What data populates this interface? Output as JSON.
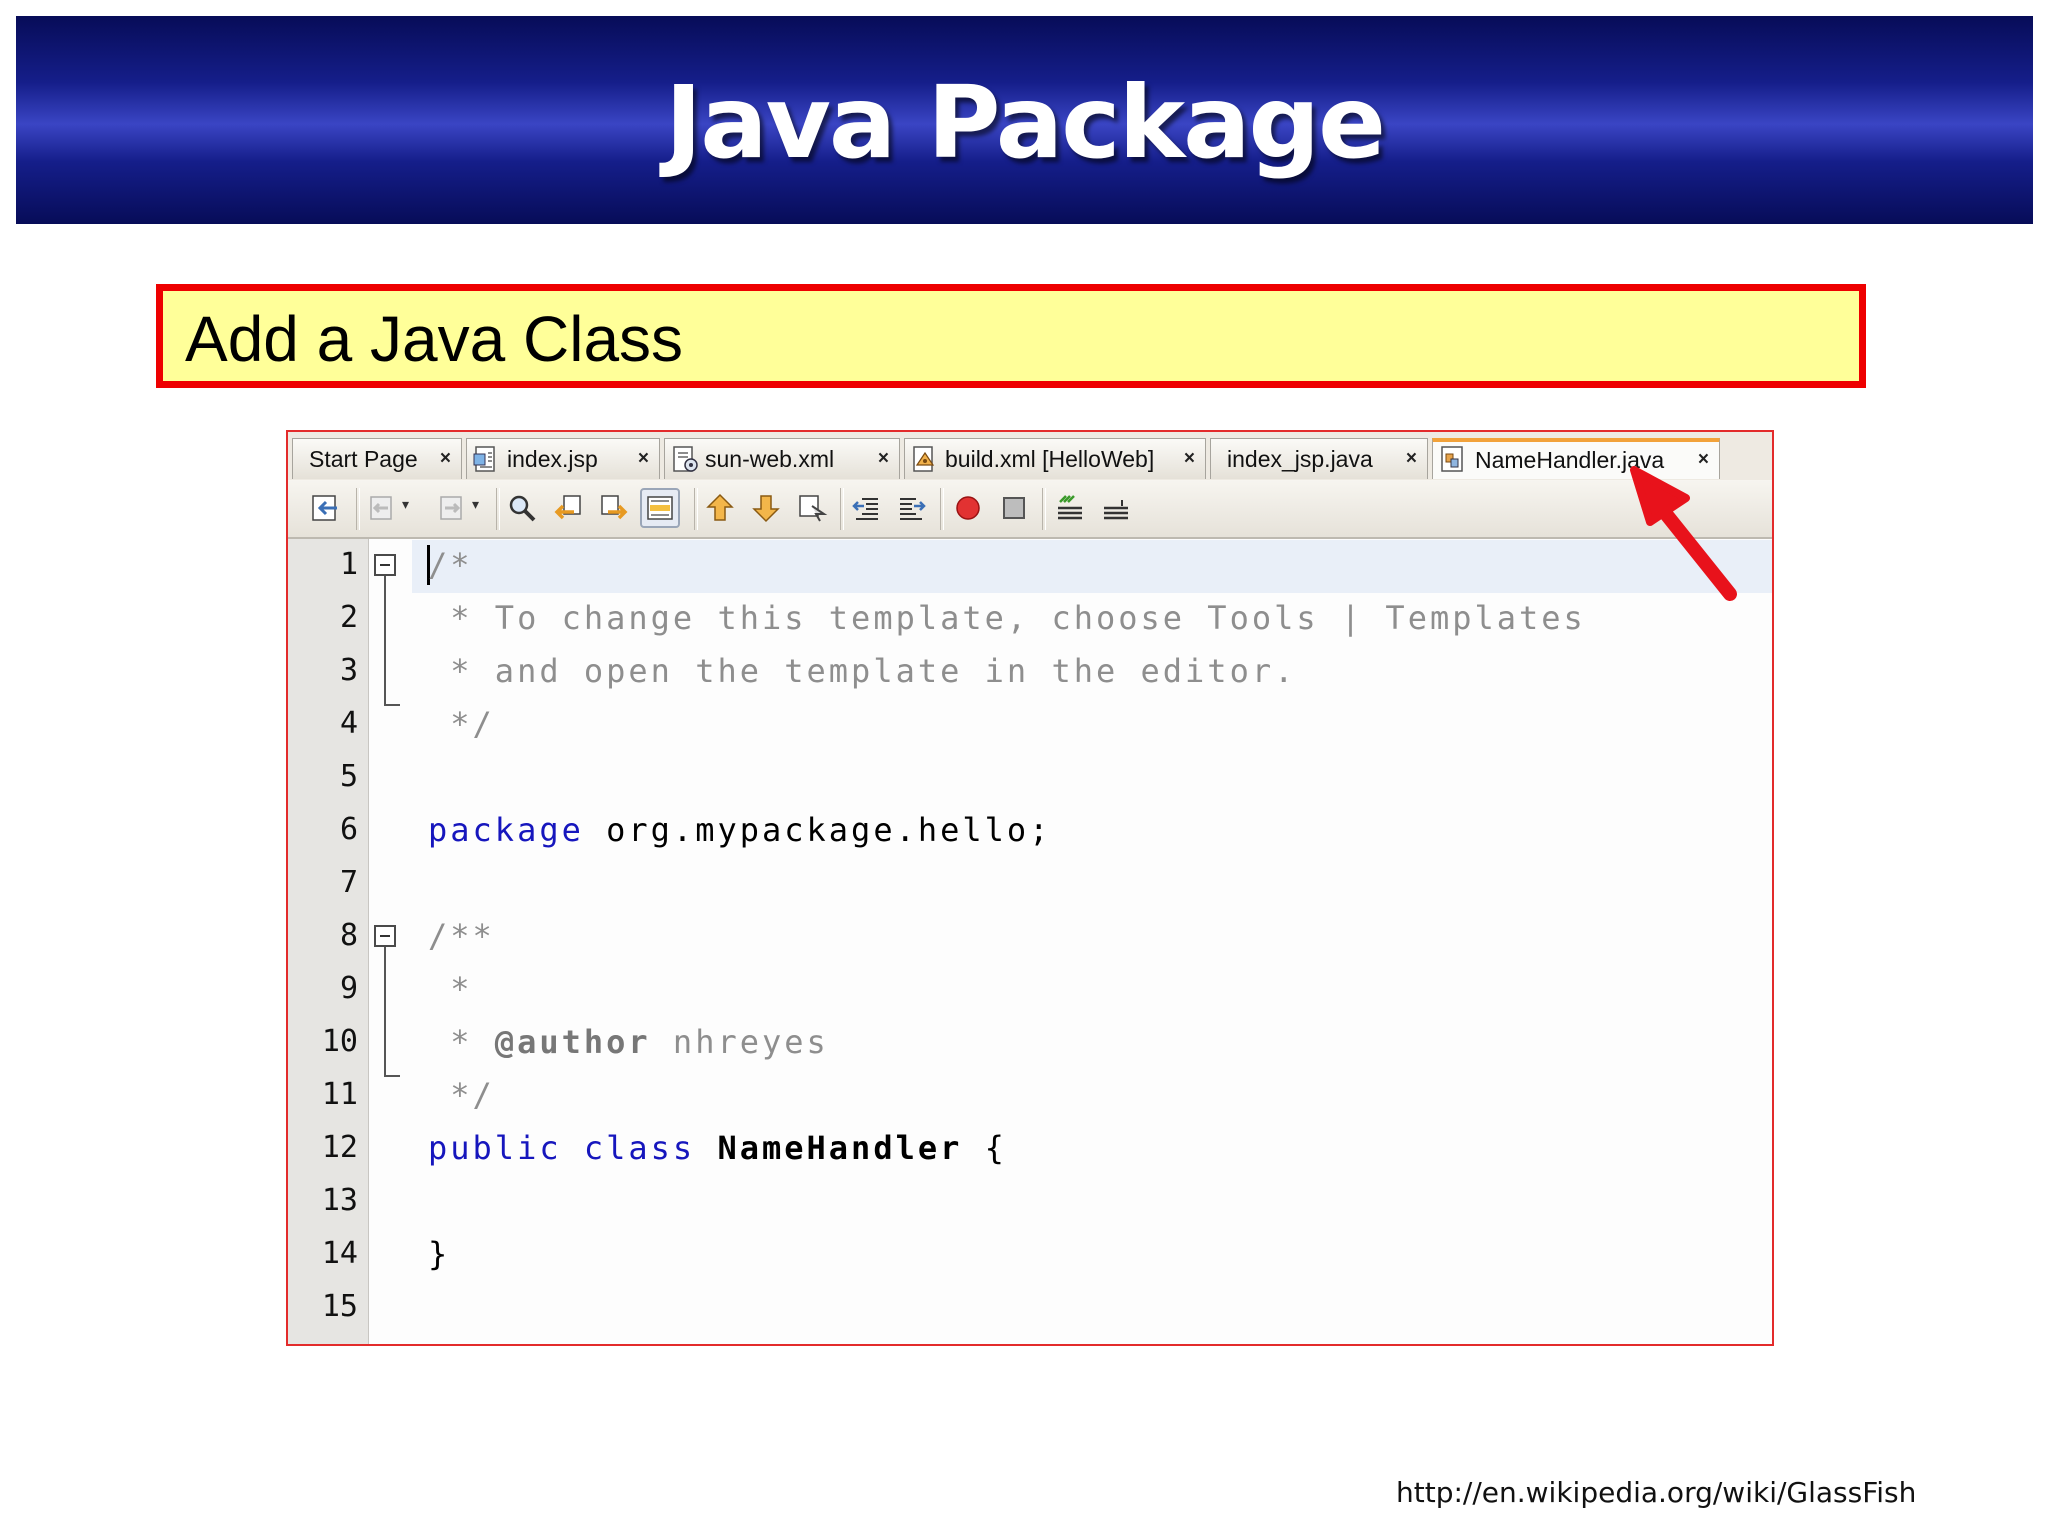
{
  "slide": {
    "title": "Java Package",
    "subtitle": "Add a Java Class",
    "source": "http://en.wikipedia.org/wiki/GlassFish"
  },
  "colors": {
    "banner": "#151e8a",
    "subtitle_border": "#ee0000",
    "subtitle_background": "#ffff99",
    "keyword": "#1616bd",
    "comment": "#8e8e8e",
    "active_tab_accent": "#f2a23a",
    "annotation_arrow": "#e8121b"
  },
  "ide": {
    "tabs": [
      {
        "label": "Start Page",
        "icon": "none",
        "active": false
      },
      {
        "label": "index.jsp",
        "icon": "jsp-file-icon",
        "active": false
      },
      {
        "label": "sun-web.xml",
        "icon": "xml-config-file-icon",
        "active": false
      },
      {
        "label": "build.xml [HelloWeb]",
        "icon": "ant-build-file-icon",
        "active": false
      },
      {
        "label": "index_jsp.java",
        "icon": "none",
        "active": false
      },
      {
        "label": "NameHandler.java",
        "icon": "java-class-file-icon",
        "active": true
      }
    ],
    "close_symbol": "×",
    "toolbar": [
      "back-to-last-edit-icon",
      "previous-bookmark-icon",
      "next-bookmark-icon",
      "find-selection-icon",
      "find-previous-icon",
      "find-next-icon",
      "toggle-highlight-search-icon",
      "previous-occurrence-icon",
      "next-occurrence-icon",
      "toggle-bookmark-icon",
      "shift-line-left-icon",
      "shift-line-right-icon",
      "start-macro-recording-icon",
      "stop-macro-recording-icon",
      "comment-icon",
      "uncomment-icon"
    ],
    "line_numbers": [
      "1",
      "2",
      "3",
      "4",
      "5",
      "6",
      "7",
      "8",
      "9",
      "10",
      "11",
      "12",
      "13",
      "14",
      "15"
    ],
    "code": {
      "l1": "/*",
      "l2": " * To change this template, choose Tools | Templates",
      "l3": " * and open the template in the editor.",
      "l4": " */",
      "l6_keyword": "package",
      "l6_rest": " org.mypackage.hello;",
      "l8": "/**",
      "l9": " *",
      "l10_star": " * ",
      "l10_tag": "@author",
      "l10_name": " nhreyes",
      "l11": " */",
      "l12_keywords": "public class",
      "l12_name": "NameHandler",
      "l12_brace": " {",
      "l14": "}"
    }
  }
}
